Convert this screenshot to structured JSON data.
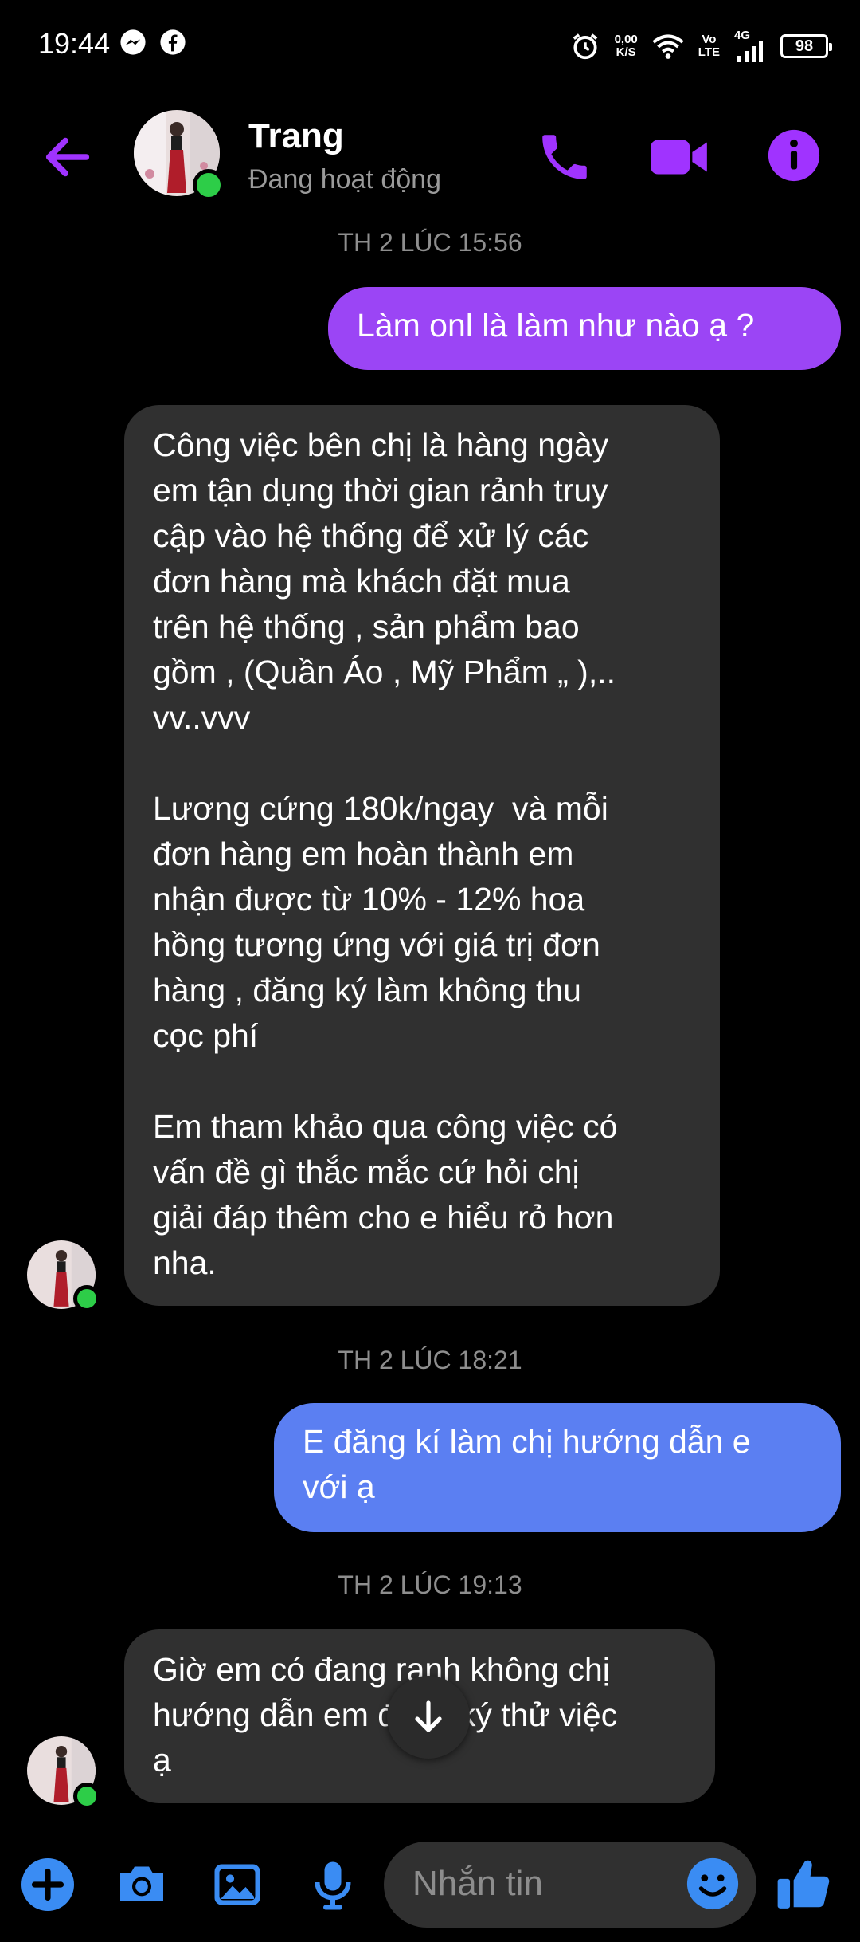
{
  "status_bar": {
    "time": "19:44",
    "net_speed_value": "0,00",
    "net_speed_unit": "K/S",
    "volte_top": "Vo",
    "volte_bottom": "LTE",
    "network": "4G",
    "battery": "98"
  },
  "header": {
    "contact_name": "Trang",
    "contact_status": "Đang hoạt động",
    "accent_color": "#a033ff",
    "online_color": "#2dcd48"
  },
  "messages": {
    "timestamp_1": "TH 2 LÚC 15:56",
    "outgoing_1": "Làm onl là làm như nào ạ ?",
    "incoming_1": "Công việc bên chị là hàng ngày\nem tận dụng thời gian rảnh truy\ncập vào hệ thống để xử lý các\nđơn hàng mà khách đặt mua\ntrên hệ thống , sản phẩm bao\ngồm , (Quần Áo , Mỹ Phẩm „ ),..\nvv..vvv\n\nLương cứng 180k/ngay  và mỗi\nđơn hàng em hoàn thành em\nnhận được từ 10% - 12% hoa\nhồng tương ứng với giá trị đơn\nhàng , đăng ký làm không thu\ncọc phí\n\nEm tham khảo qua công việc có\nvấn đề gì thắc mắc cứ hỏi chị\ngiải đáp thêm cho e hiểu rỏ hơn\nnha.",
    "timestamp_2": "TH 2 LÚC 18:21",
    "outgoing_2": "E đăng kí làm chị hướng dẫn e\nvới ạ",
    "timestamp_3": "TH 2 LÚC 19:13",
    "incoming_2": "Giờ em có đang ranh không chị\nhướng dẫn em đăng ký thử việc\nạ",
    "outgoing_1_color": "#9b45f5",
    "outgoing_2_color": "#5b7ff2",
    "incoming_color": "#303030"
  },
  "composer": {
    "placeholder": "Nhắn tin",
    "icons": [
      "plus-icon",
      "camera-icon",
      "gallery-icon",
      "microphone-icon",
      "emoji-icon",
      "thumbs-up-icon"
    ],
    "icon_color": "#3a8cf3"
  }
}
